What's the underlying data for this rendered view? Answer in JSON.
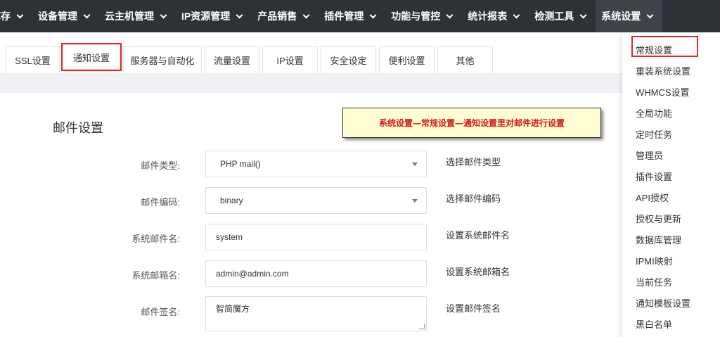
{
  "nav": {
    "items": [
      {
        "label": "库存"
      },
      {
        "label": "设备管理"
      },
      {
        "label": "云主机管理"
      },
      {
        "label": "IP资源管理"
      },
      {
        "label": "产品销售"
      },
      {
        "label": "插件管理"
      },
      {
        "label": "功能与管控"
      },
      {
        "label": "统计报表"
      },
      {
        "label": "检测工具"
      },
      {
        "label": "系统设置"
      }
    ]
  },
  "tabs": [
    {
      "label": "SSL设置"
    },
    {
      "label": "通知设置"
    },
    {
      "label": "服务器与自动化"
    },
    {
      "label": "流量设置"
    },
    {
      "label": "IP设置"
    },
    {
      "label": "安全设定"
    },
    {
      "label": "便利设置"
    },
    {
      "label": "其他"
    }
  ],
  "section": {
    "title": "邮件设置"
  },
  "annotation": {
    "text": "系统设置—常规设置—通知设置里对邮件进行设置"
  },
  "form": {
    "mail_type": {
      "label": "邮件类型:",
      "value": "PHP mail()",
      "hint": "选择邮件类型"
    },
    "mail_encoding": {
      "label": "邮件编码:",
      "value": "binary",
      "hint": "选择邮件编码"
    },
    "system_mail_name": {
      "label": "系统邮件名:",
      "value": "system",
      "hint": "设置系统邮件名"
    },
    "system_mailbox": {
      "label": "系统邮箱名:",
      "value": "admin@admin.com",
      "hint": "设置系统邮箱名"
    },
    "mail_signature": {
      "label": "邮件签名:",
      "value": "智简魔方",
      "hint": "设置邮件签名"
    }
  },
  "dropdown": {
    "items": [
      {
        "label": "常规设置"
      },
      {
        "label": "重装系统设置"
      },
      {
        "label": "WHMCS设置"
      },
      {
        "label": "全局功能"
      },
      {
        "label": "定时任务"
      },
      {
        "label": "管理员"
      },
      {
        "label": "插件设置"
      },
      {
        "label": "API授权"
      },
      {
        "label": "授权与更新"
      },
      {
        "label": "数据库管理"
      },
      {
        "label": "IPMI映射"
      },
      {
        "label": "当前任务"
      },
      {
        "label": "通知模板设置"
      },
      {
        "label": "黑白名单"
      }
    ]
  }
}
